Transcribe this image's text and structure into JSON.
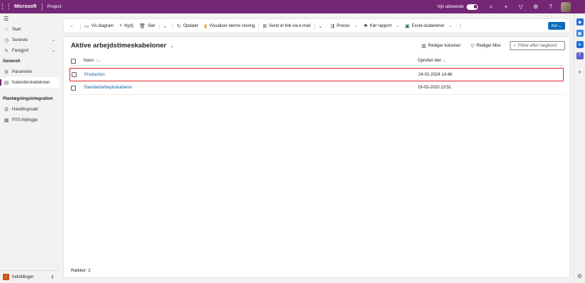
{
  "topbar": {
    "brand": "Microsoft",
    "app_name": "Project",
    "new_look_label": "Nyt udseende",
    "icons": [
      "search-icon",
      "plus-icon",
      "filter-icon",
      "gear-icon",
      "help-icon"
    ]
  },
  "leftnav": {
    "items": [
      {
        "label": "Start",
        "icon": "home-icon"
      },
      {
        "label": "Seneste",
        "icon": "clock-icon"
      },
      {
        "label": "Fastgjort",
        "icon": "pin-icon"
      }
    ],
    "section1": "Generelt",
    "general_items": [
      {
        "label": "Parametre",
        "icon": "settings-icon"
      },
      {
        "label": "Kalenderskabeloner",
        "icon": "calendar-icon"
      }
    ],
    "section2": "Planlægningsintegration",
    "integration_items": [
      {
        "label": "Handlingssæt",
        "icon": "list-icon"
      },
      {
        "label": "PSS-fejllogge",
        "icon": "log-icon"
      }
    ],
    "area_badge": "I",
    "area_label": "Indstillinger"
  },
  "cmdbar": {
    "show_chart": "Vis diagram",
    "new": "Ny(t)",
    "delete": "Slet",
    "refresh": "Opdater",
    "visualize": "Visualiser denne visning",
    "email_link": "Send et link via e-mail",
    "process": "Proces",
    "run_report": "Kør rapport",
    "excel_templates": "Excel-skabeloner",
    "share": "Del"
  },
  "view": {
    "title": "Aktive arbejdstimeskabeloner",
    "edit_columns": "Rediger kolonner",
    "edit_filters": "Rediger filtre",
    "filter_placeholder": "Filtrer efter nøgleord",
    "columns": {
      "name": "Navn",
      "created": "Oprettet den"
    },
    "rows": [
      {
        "name": "Production",
        "created": "24-02-2024 14:48"
      },
      {
        "name": "Standardarbejdsskabelon",
        "created": "19-03-2020 13:51"
      }
    ],
    "footer": "Rækker: 2"
  },
  "colors": {
    "topbar": "#742774",
    "accent": "#0f6cbd",
    "highlight": "#e02424"
  }
}
